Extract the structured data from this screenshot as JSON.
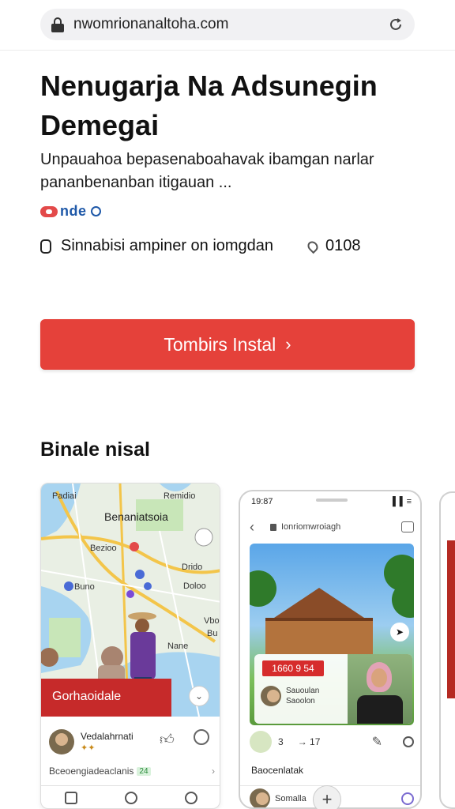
{
  "browser": {
    "url": "nwomrionanaltoha.com"
  },
  "app": {
    "title": "Nenugarja Na Adsunegin Demegai",
    "description": "Unpauahoa bepasenaboahavak ibamgan narlar pananbenanban itigauan ...",
    "badge_text": "nde",
    "meta_text": "Sinnabisi ampiner on iomgdan",
    "meta_count": "0108",
    "install_label": "Tombirs Instal",
    "install_chevron": "›"
  },
  "screenshots": {
    "section_title": "Binale nisal",
    "card1": {
      "map_place": "Benaniatsoia",
      "map_labels": [
        "Padiai",
        "Remidio",
        "Bezioo",
        "Buno",
        "Drido",
        "Doloo",
        "Vbo",
        "Bu",
        "Nane"
      ],
      "banner": "Gorhaoidale",
      "user_name": "Vedalahrnati",
      "user_sub": "✦✦",
      "footer_text": "Bceoengiadeaclanis",
      "footer_tag": "24",
      "footer_arrow": "›"
    },
    "card2": {
      "time": "19:87",
      "signal": "▐▐ ≡",
      "url": "Ionriomwroiagh",
      "overlay_red": "1660 9 54",
      "overlay_name": "Sauoulan",
      "overlay_sub": "Saoolon",
      "action_count": "3",
      "action_share": "17",
      "share_arrow": "→",
      "label": "Baocenlatak",
      "bottom_user": "Somalla",
      "fab_plus": "+"
    }
  },
  "colors": {
    "accent_red": "#e5413a",
    "badge_blue": "#1e58a8"
  }
}
